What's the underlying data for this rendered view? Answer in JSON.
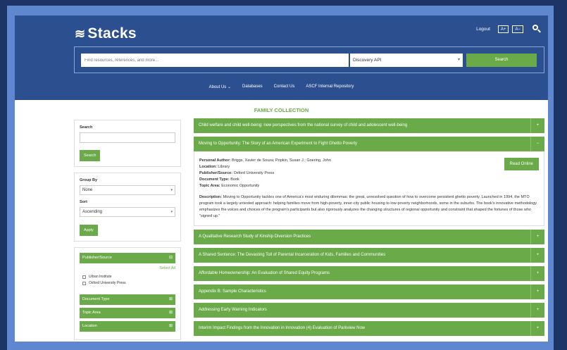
{
  "app": {
    "name": "Stacks"
  },
  "header": {
    "logout": "Logout",
    "font_increase": "A+",
    "font_decrease": "A−"
  },
  "search": {
    "placeholder": "Find resources, references, and more...",
    "source": "Discovery API",
    "button": "Search"
  },
  "nav": [
    "About Us ⌄",
    "Databases",
    "Contact Us",
    "ASCF Internal Repository"
  ],
  "collection_title": "FAMILY COLLECTION",
  "sidebar": {
    "search_label": "Search",
    "search_button": "Search",
    "group_by_label": "Group By",
    "group_by_value": "None",
    "sort_label": "Sort",
    "sort_value": "Ascending",
    "apply_button": "Apply",
    "facets": [
      {
        "label": "Publisher/Source"
      },
      {
        "label": "Document Type"
      },
      {
        "label": "Topic Area"
      },
      {
        "label": "Location"
      }
    ],
    "select_all": "Select All",
    "publisher_options": [
      "Urban Institute",
      "Oxford University Press"
    ]
  },
  "results": {
    "items": [
      "Child welfare and child well-being: new perspectives from the national survey of child and adolescent well-being",
      "Moving to Opportunity: The Story of an American Experiment to Fight Ghetto Poverty",
      "A Qualitative Research Study of Kinship Diversion Practices",
      "A Shared Sentence: The Devasting Toll of Parental Incarceration of Kids, Families and Communities",
      "Affordable Homeownership: An Evaluation of Shared Equity Programs",
      "Appendix B: Sample Characteristics",
      "Addressing Early Warning Indicators",
      "Interim Impact Findings from the Innovation in Innovation (4) Evaluation of Parkview Now"
    ],
    "toggle_collapsed": "+",
    "toggle_expanded": "−",
    "detail": {
      "author_label": "Personal Author:",
      "author": "Briggs, Xavier de Souza; Popkin, Susan J.; Goering, John",
      "location_label": "Location:",
      "location": "Library",
      "publisher_label": "Publisher/Source:",
      "publisher": "Oxford University Press",
      "doctype_label": "Document Type:",
      "doctype": "Book",
      "topic_label": "Topic Area:",
      "topic": "Economic Opportunity",
      "description_label": "Description:",
      "description": "Moving to Opportunity tackles one of America's most enduring dilemmas: the great, unresolved question of how to overcome persistent ghetto poverty. Launched in 1994, the MTO program took a largely untested approach: helping families move from high-poverty, inner-city public housing to low-poverty neighborhoods, some in the suburbs. The book's innovative methodology emphasizes the voices and choices of the program's participants but also rigorously analyzes the changing structures of regional opportunity and constraint that shaped the fortunes of those who \"signed up.\"",
      "read_online": "Read Online"
    }
  },
  "colors": {
    "navy": "#2c4f8f",
    "green": "#6aaa48",
    "frame": "#5f87d0",
    "background": "#1c3566"
  }
}
